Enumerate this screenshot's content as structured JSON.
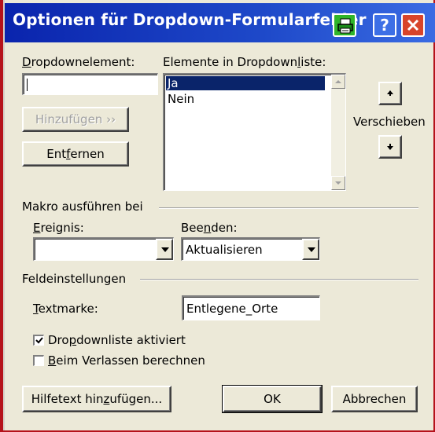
{
  "window": {
    "title": "Optionen für Dropdown-Formularfelder",
    "help_label": "?"
  },
  "dropdown_element": {
    "label_pre": "",
    "label_accel": "D",
    "label_post": "ropdownelement:",
    "value": "",
    "add_button": "Hinzufügen ››",
    "remove_button_pre": "Ent",
    "remove_button_accel": "f",
    "remove_button_post": "ernen"
  },
  "list": {
    "label_pre": "Elemente in Dropdown",
    "label_accel": "l",
    "label_post": "iste:",
    "items": [
      "Ja",
      "Nein"
    ],
    "selected_index": 0,
    "move_label": "Verschieben"
  },
  "macro": {
    "group_label": "Makro ausführen bei",
    "event_label_pre": "",
    "event_label_accel": "E",
    "event_label_post": "reignis:",
    "event_value": "",
    "exit_label_pre": "Bee",
    "exit_label_accel": "n",
    "exit_label_post": "den:",
    "exit_value": "Aktualisieren"
  },
  "field_settings": {
    "group_label": "Feldeinstellungen",
    "bookmark_label_pre": "",
    "bookmark_label_accel": "T",
    "bookmark_label_post": "extmarke:",
    "bookmark_value": "Entlegene_Orte",
    "dropdown_enabled_pre": "Dro",
    "dropdown_enabled_accel": "p",
    "dropdown_enabled_post": "downliste aktiviert",
    "dropdown_enabled_checked": true,
    "calc_on_exit_pre": "",
    "calc_on_exit_accel": "B",
    "calc_on_exit_post": "eim Verlassen berechnen",
    "calc_on_exit_checked": false
  },
  "buttons": {
    "help_text_pre": "Hilfetext hin",
    "help_text_accel": "z",
    "help_text_post": "ufügen...",
    "ok": "OK",
    "cancel": "Abbrechen"
  },
  "colors": {
    "titlebar": "#0a24ad",
    "selection": "#0a246a",
    "frame": "#b5121b"
  }
}
